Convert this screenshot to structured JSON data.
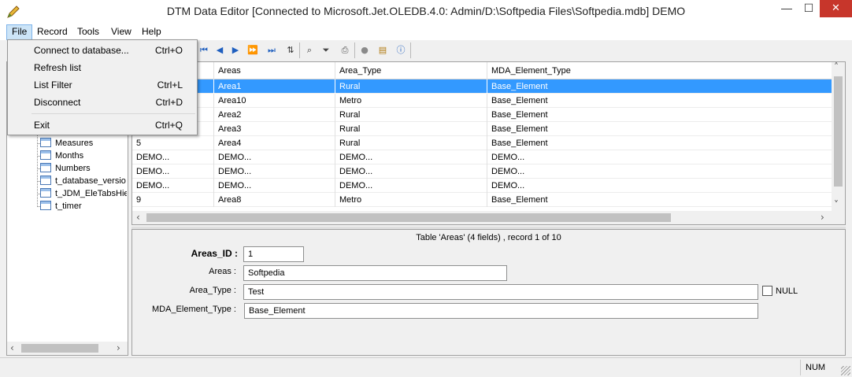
{
  "window": {
    "title": "DTM Data Editor [Connected to Microsoft.Jet.OLEDB.4.0: Admin/D:\\Softpedia Files\\Softpedia.mdb] DEMO",
    "min_glyph": "—",
    "max_glyph": "☐",
    "close_glyph": "✕"
  },
  "menu": {
    "file": "File",
    "record": "Record",
    "tools": "Tools",
    "view": "View",
    "help": "Help"
  },
  "file_menu": {
    "items": [
      {
        "label": "Connect to database...",
        "shortcut": "Ctrl+O"
      },
      {
        "label": "Refresh list",
        "shortcut": ""
      },
      {
        "label": "List Filter",
        "shortcut": "Ctrl+L"
      },
      {
        "label": "Disconnect",
        "shortcut": "Ctrl+D"
      },
      {
        "label": "Exit",
        "shortcut": "Ctrl+Q"
      }
    ]
  },
  "toolbar": {
    "icons": [
      "first-record-icon",
      "prev-page-icon",
      "prev-record-icon",
      "next-record-icon",
      "next-page-icon",
      "last-record-icon",
      "sort-az-icon",
      "find-icon",
      "filter-icon",
      "print-icon",
      "stop-icon",
      "properties-icon",
      "help-icon"
    ]
  },
  "tree": {
    "items": [
      "Measures",
      "Months",
      "Numbers",
      "t_database_versio",
      "t_JDM_EleTabsHie",
      "t_timer"
    ]
  },
  "grid": {
    "columns": [
      "",
      "Areas",
      "Area_Type",
      "MDA_Element_Type"
    ],
    "rows": [
      [
        "",
        "Area1",
        "Rural",
        "Base_Element"
      ],
      [
        "",
        "Area10",
        "Metro",
        "Base_Element"
      ],
      [
        "",
        "Area2",
        "Rural",
        "Base_Element"
      ],
      [
        "",
        "Area3",
        "Rural",
        "Base_Element"
      ],
      [
        "5",
        "Area4",
        "Rural",
        "Base_Element"
      ],
      [
        "DEMO...",
        "DEMO...",
        "DEMO...",
        "DEMO..."
      ],
      [
        "DEMO...",
        "DEMO...",
        "DEMO...",
        "DEMO..."
      ],
      [
        "DEMO...",
        "DEMO...",
        "DEMO...",
        "DEMO..."
      ],
      [
        "9",
        "Area8",
        "Metro",
        "Base_Element"
      ]
    ],
    "selected_row": 0
  },
  "form": {
    "title": "Table 'Areas' (4 fields) , record 1 of 10",
    "fields": [
      {
        "label": "Areas_ID :",
        "value": "1"
      },
      {
        "label": "Areas :",
        "value": "Softpedia"
      },
      {
        "label": "Area_Type :",
        "value": "Test"
      },
      {
        "label": "MDA_Element_Type :",
        "value": "Base_Element"
      }
    ],
    "null_label": "NULL"
  },
  "status": {
    "num": "NUM"
  },
  "colors": {
    "selection": "#3399ff",
    "close_button": "#c7362b",
    "menu_highlight": "#cce4f7"
  }
}
